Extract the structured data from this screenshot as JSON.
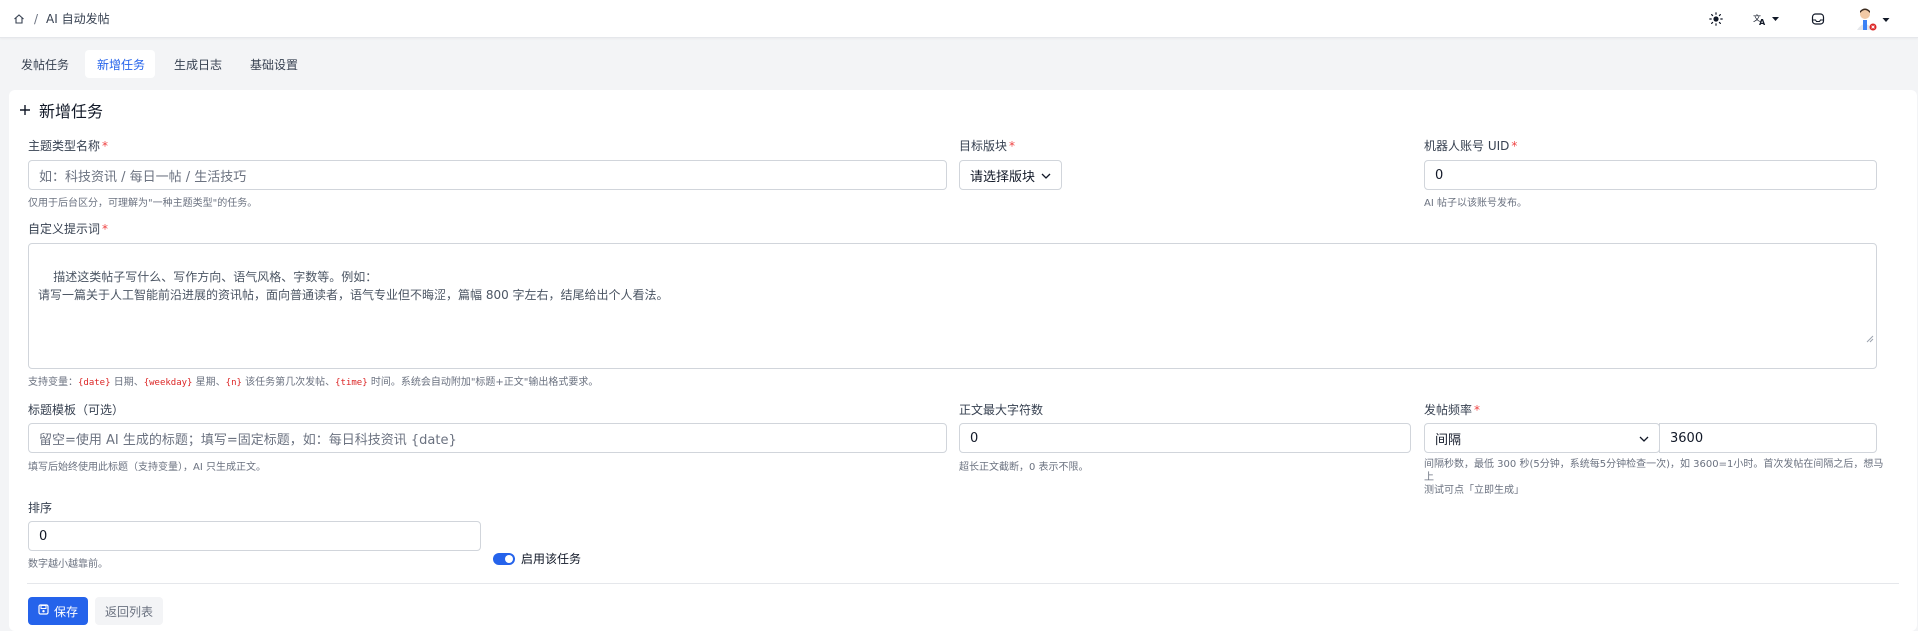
{
  "breadcrumb": {
    "separator": "/",
    "current": "AI 自动发帖"
  },
  "tabs": [
    {
      "label": "发帖任务"
    },
    {
      "label": "新增任务"
    },
    {
      "label": "生成日志"
    },
    {
      "label": "基础设置"
    }
  ],
  "form": {
    "title": "新增任务",
    "topic": {
      "label": "主题类型名称",
      "required": "*",
      "placeholder": "如：科技资讯 / 每日一帖 / 生活技巧",
      "help": "仅用于后台区分，可理解为\"一种主题类型\"的任务。"
    },
    "board": {
      "label": "目标版块",
      "required": "*",
      "value": "请选择版块"
    },
    "robot": {
      "label": "机器人账号 UID",
      "required": "*",
      "value": "0",
      "help": "AI 帖子以该账号发布。"
    },
    "prompt": {
      "label": "自定义提示词",
      "required": "*",
      "placeholder": "描述这类帖子写什么、写作方向、语气风格、字数等。例如：\n请写一篇关于人工智能前沿进展的资讯帖，面向普通读者，语气专业但不晦涩，篇幅 800 字左右，结尾给出个人看法。",
      "help_prefix": "支持变量：",
      "var_date": "{date}",
      "txt_date": " 日期、",
      "var_weekday": "{weekday}",
      "txt_weekday": " 星期、",
      "var_n": "{n}",
      "txt_n": " 该任务第几次发帖、",
      "var_time": "{time}",
      "txt_time": " 时间。系统会自动附加\"标题+正文\"输出格式要求。"
    },
    "title_template": {
      "label": "标题模板（可选）",
      "placeholder": "留空=使用 AI 生成的标题；填写=固定标题，如：每日科技资讯 {date}",
      "help": "填写后始终使用此标题（支持变量），AI 只生成正文。"
    },
    "max_chars": {
      "label": "正文最大字符数",
      "value": "0",
      "help": "超长正文截断，0 表示不限。"
    },
    "frequency": {
      "label": "发帖频率",
      "required": "*",
      "mode": "间隔",
      "value": "3600",
      "help_line1": "间隔秒数，最低 300 秒(5分钟，系统每5分钟检查一次)，如 3600=1小时。首次发帖在间隔之后，想马上",
      "help_line2": "测试可点「立即生成」"
    },
    "sort": {
      "label": "排序",
      "value": "0",
      "help": "数字越小越靠前。"
    },
    "enable": {
      "label": "启用该任务",
      "on": true
    },
    "save_label": "保存",
    "back_label": "返回列表"
  },
  "colors": {
    "primary": "#2563eb",
    "required": "#ef4444",
    "variable": "#dc2626"
  }
}
